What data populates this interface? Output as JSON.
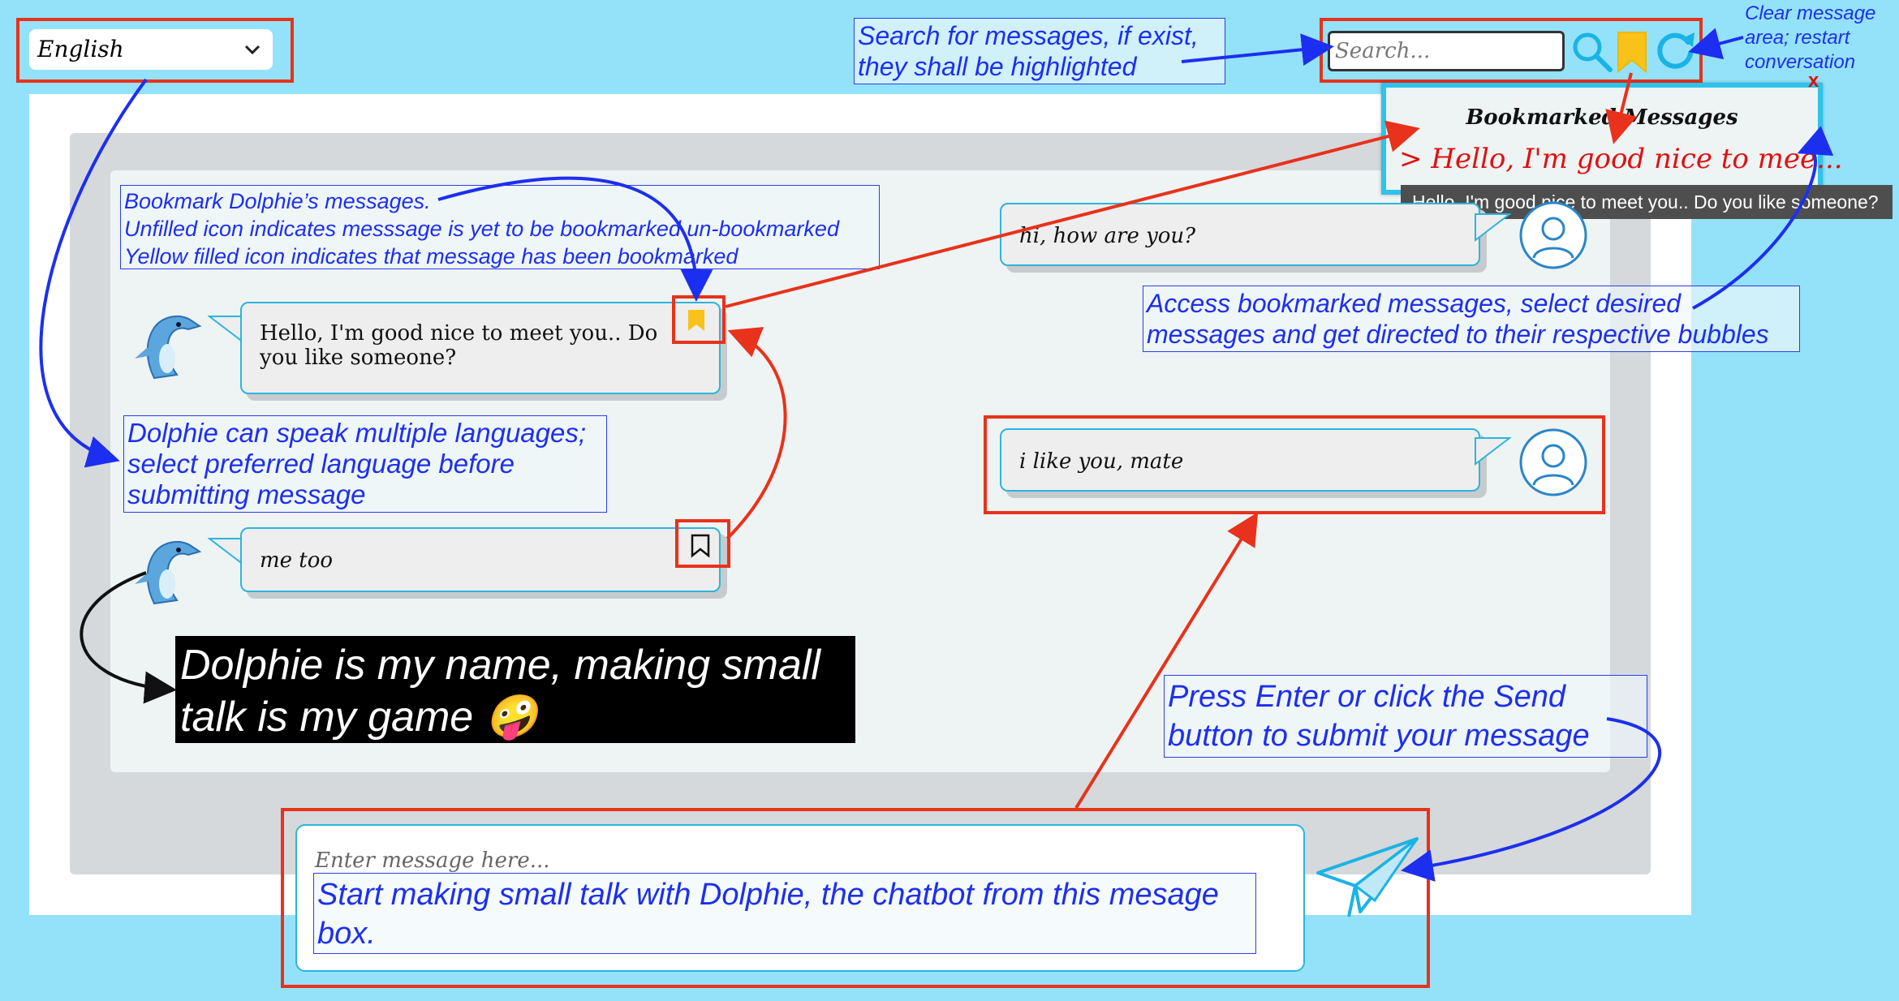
{
  "language_select": {
    "value": "English"
  },
  "search": {
    "placeholder": "Search..."
  },
  "bookmarks_panel": {
    "title": "Bookmarked Messages",
    "item": "> Hello, I'm good nice to mee...",
    "close": "x",
    "tooltip": "Hello, I'm good nice to meet you.. Do you like someone?"
  },
  "messages": [
    {
      "sender": "bot",
      "text": "Hello, I'm good nice to meet you.. Do you like someone?",
      "bookmarked": true
    },
    {
      "sender": "user",
      "text": "hi, how are you?"
    },
    {
      "sender": "user",
      "text": "i like you, mate"
    },
    {
      "sender": "bot",
      "text": "me too",
      "bookmarked": false
    }
  ],
  "composer": {
    "placeholder": "Enter message here..."
  },
  "annotations": {
    "search": "Search for messages, if exist, they shall be highlighted",
    "clear": "Clear message area; restart conversation",
    "bookmark_line1": "Bookmark Dolphie’s messages.",
    "bookmark_line2": "Unfilled icon indicates messsage is yet to be bookmarked un-bookmarked",
    "bookmark_line3": "Yellow filled icon indicates that message has been bookmarked",
    "access": "Access bookmarked messages, select desired messages and get directed to their respective bubbles",
    "languages": "Dolphie can speak multiple languages; select preferred language before submitting message",
    "name": "Dolphie is my name, making small talk is my game 🤪",
    "send": "Press Enter or click the Send button to submit your message",
    "compose": "Start making small talk with Dolphie, the chatbot from this mesage box."
  },
  "colors": {
    "background": "#94e2f9",
    "accent_border": "#2cb5dc",
    "highlight_red": "#e8321b",
    "annotation_blue": "#1c2ff0",
    "bookmark_yellow": "#f8c21a"
  },
  "icons": [
    "chevron-down-icon",
    "search-icon",
    "bookmark-icon",
    "refresh-icon",
    "user-icon",
    "dolphin-icon",
    "send-icon"
  ]
}
